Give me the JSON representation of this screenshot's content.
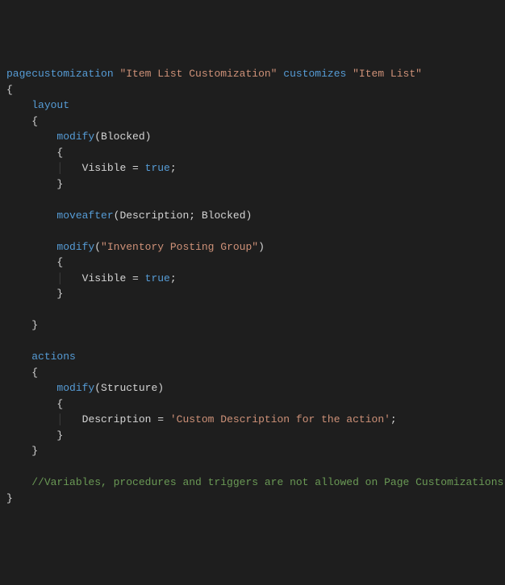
{
  "code": {
    "line1_kw1": "pagecustomization",
    "line1_str1": "\"Item List Customization\"",
    "line1_kw2": "customizes",
    "line1_str2": "\"Item List\"",
    "line2_brace_open": "{",
    "line3_layout": "layout",
    "line4_brace_open": "{",
    "line5_modify": "modify",
    "line5_arg": "Blocked",
    "line6_brace_open": "{",
    "line7_visible": "Visible",
    "line7_eq": " = ",
    "line7_true": "true",
    "line7_semi": ";",
    "line8_brace_close": "}",
    "line10_moveafter": "moveafter",
    "line10_arg1": "Description",
    "line10_sep": "; ",
    "line10_arg2": "Blocked",
    "line12_modify": "modify",
    "line12_str": "\"Inventory Posting Group\"",
    "line13_brace_open": "{",
    "line14_visible": "Visible",
    "line14_eq": " = ",
    "line14_true": "true",
    "line14_semi": ";",
    "line15_brace_close": "}",
    "line17_brace_close": "}",
    "line19_actions": "actions",
    "line20_brace_open": "{",
    "line21_modify": "modify",
    "line21_arg": "Structure",
    "line22_brace_open": "{",
    "line23_desc": "Description",
    "line23_eq": " = ",
    "line23_str": "'Custom Description for the action'",
    "line23_semi": ";",
    "line24_brace_close": "}",
    "line25_brace_close": "}",
    "line27_comment": "//Variables, procedures and triggers are not allowed on Page Customizations",
    "line28_brace_close": "}"
  }
}
